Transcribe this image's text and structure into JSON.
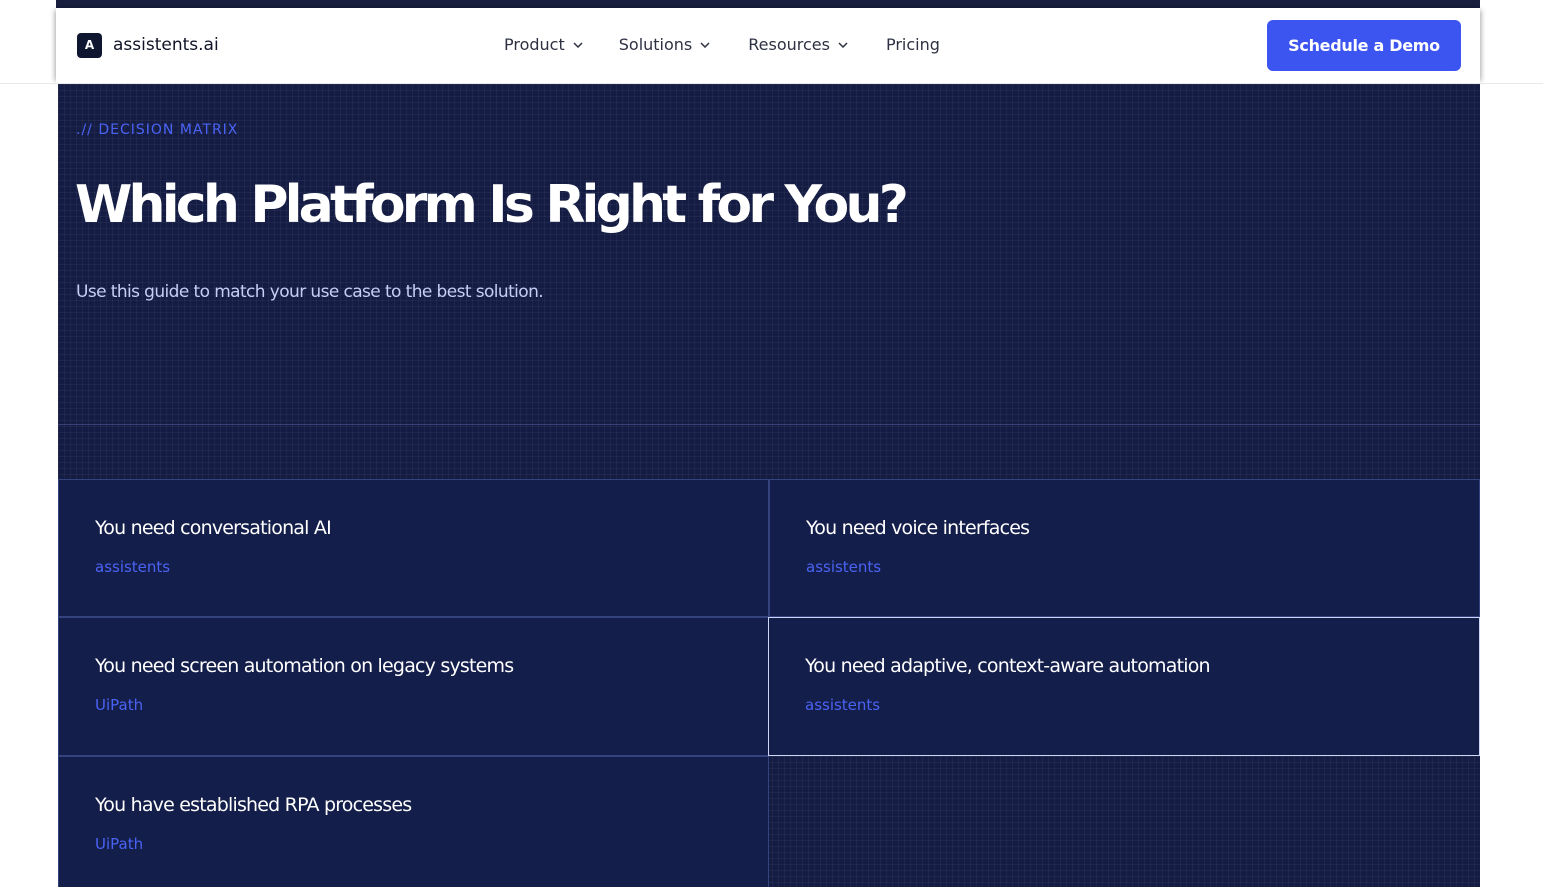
{
  "brand": {
    "logo_letter": "A",
    "name": "assistents.ai"
  },
  "nav": {
    "items": [
      {
        "label": "Product"
      },
      {
        "label": "Solutions"
      },
      {
        "label": "Resources"
      },
      {
        "label": "Pricing"
      }
    ],
    "cta": "Schedule a Demo"
  },
  "hero": {
    "eyebrow": ".// DECISION MATRIX",
    "title": "Which Platform Is Right for You?",
    "subtitle": "Use this guide to match your use case to the best solution."
  },
  "cards": [
    {
      "title": "You need conversational AI",
      "answer": "assistents"
    },
    {
      "title": "You need voice interfaces",
      "answer": "assistents"
    },
    {
      "title": "You need screen automation on legacy systems",
      "answer": "UiPath"
    },
    {
      "title": "You need adaptive, context-aware automation",
      "answer": "assistents"
    },
    {
      "title": "You have established RPA processes",
      "answer": "UiPath"
    }
  ],
  "colors": {
    "accent": "#3d55f0",
    "hero_bg": "#141c44",
    "card_bg": "#141e4a",
    "link": "#4a63f5"
  },
  "icons": [
    "chevron-down-icon"
  ]
}
